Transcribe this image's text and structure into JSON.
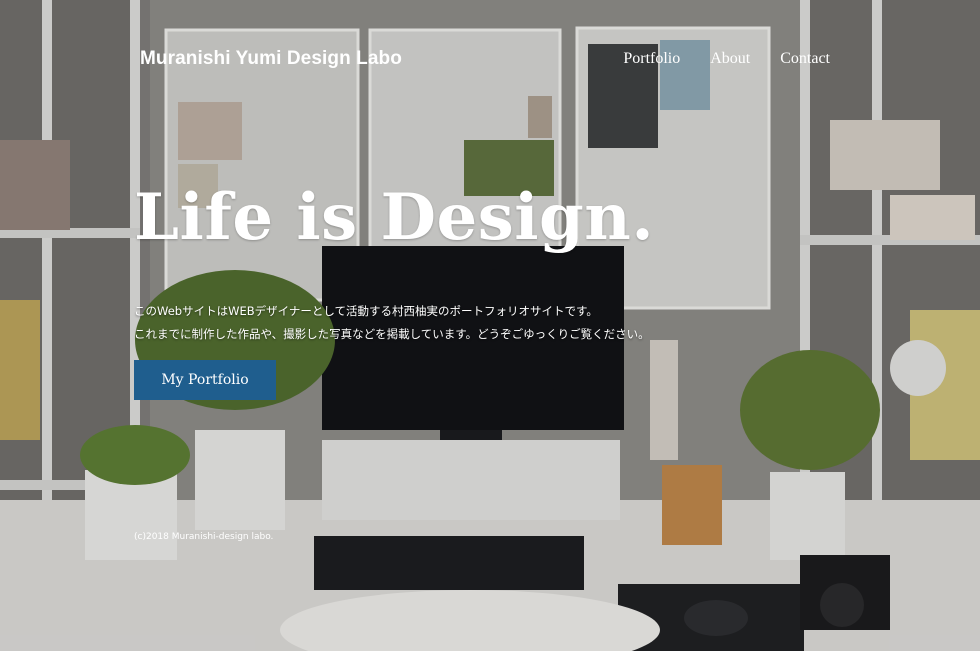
{
  "header": {
    "brand": "Muranishi Yumi Design Labo",
    "nav": [
      {
        "label": "Portfolio"
      },
      {
        "label": "About"
      },
      {
        "label": "Contact"
      }
    ]
  },
  "hero": {
    "headline": "Life is Design.",
    "description": [
      "このWebサイトはWEBデザイナーとして活動する村西柚実のポートフォリオサイトです。",
      "これまでに制作した作品や、撮影した写真などを掲載しています。どうぞごゆっくりご覧ください。"
    ],
    "cta_label": "My Portfolio",
    "cta_color": "#1f5e8e"
  },
  "footer": {
    "copyright": "(c)2018 Muranishi-design labo."
  }
}
